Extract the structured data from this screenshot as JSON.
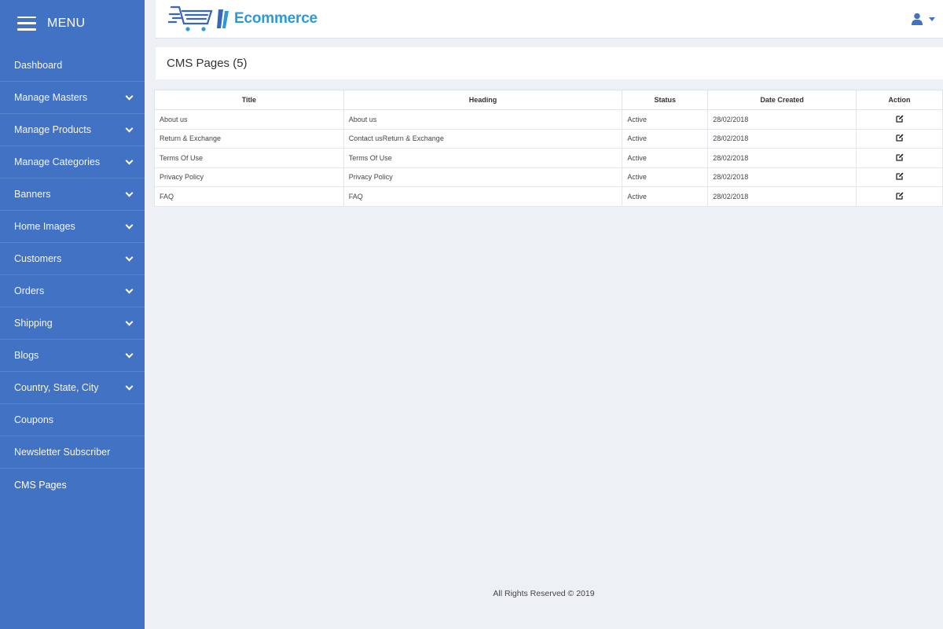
{
  "sidebar": {
    "menu_label": "MENU",
    "items": [
      {
        "label": "Dashboard",
        "has_submenu": false
      },
      {
        "label": "Manage Masters",
        "has_submenu": true
      },
      {
        "label": "Manage Products",
        "has_submenu": true
      },
      {
        "label": "Manage Categories",
        "has_submenu": true
      },
      {
        "label": "Banners",
        "has_submenu": true
      },
      {
        "label": "Home Images",
        "has_submenu": true
      },
      {
        "label": "Customers",
        "has_submenu": true
      },
      {
        "label": "Orders",
        "has_submenu": true
      },
      {
        "label": "Shipping",
        "has_submenu": true
      },
      {
        "label": "Blogs",
        "has_submenu": true
      },
      {
        "label": "Country, State, City",
        "has_submenu": true
      },
      {
        "label": "Coupons",
        "has_submenu": false
      },
      {
        "label": "Newsletter Subscriber",
        "has_submenu": false
      },
      {
        "label": "CMS Pages",
        "has_submenu": false,
        "active": true
      }
    ]
  },
  "header": {
    "logo_text": "Ecommerce",
    "icons": [
      "cart-logo-icon",
      "user-icon",
      "caret-down-icon"
    ]
  },
  "page": {
    "title": "CMS Pages (5)"
  },
  "table": {
    "columns": [
      "Title",
      "Heading",
      "Status",
      "Date Created",
      "Action"
    ],
    "rows": [
      {
        "title": "About us",
        "heading": "About us",
        "status": "Active",
        "date": "28/02/2018"
      },
      {
        "title": "Return & Exchange",
        "heading": "Contact usReturn & Exchange",
        "status": "Active",
        "date": "28/02/2018"
      },
      {
        "title": "Terms Of Use",
        "heading": "Terms Of Use",
        "status": "Active",
        "date": "28/02/2018"
      },
      {
        "title": "Privacy Policy",
        "heading": "Privacy Policy",
        "status": "Active",
        "date": "28/02/2018"
      },
      {
        "title": "FAQ",
        "heading": "FAQ",
        "status": "Active",
        "date": "28/02/2018"
      }
    ]
  },
  "footer": {
    "text": "All Rights Reserved © 2019"
  },
  "colors": {
    "sidebar": "#4272c4",
    "background": "#edf0f5",
    "logo_text": "#2b9bd8"
  }
}
